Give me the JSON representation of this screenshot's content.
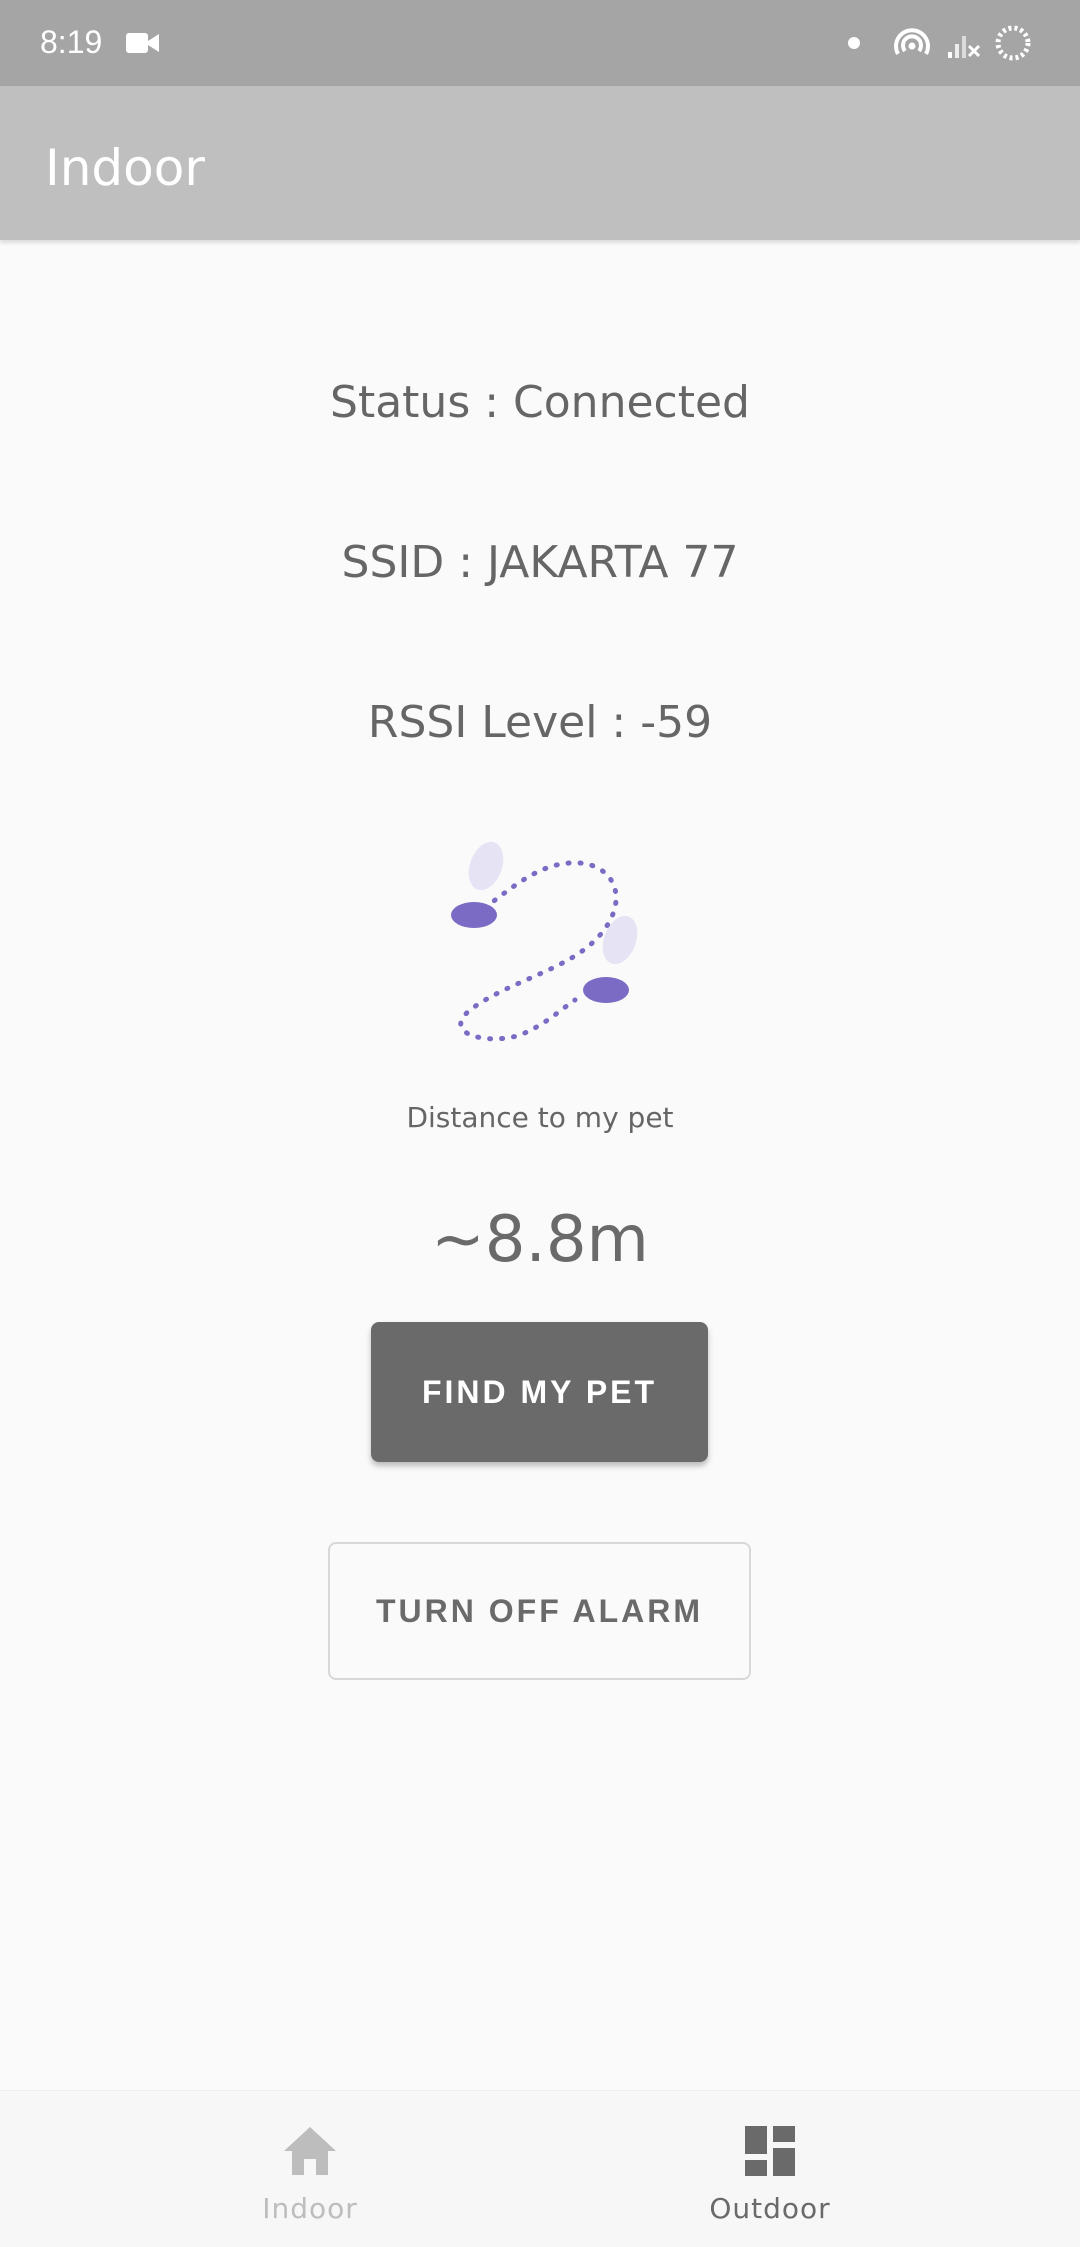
{
  "status_bar": {
    "time": "8:19",
    "icons": [
      "video-camera-icon",
      "dot-icon",
      "hotspot-icon",
      "signal-no-service-icon",
      "loading-circle-icon"
    ]
  },
  "app_bar": {
    "title": "Indoor"
  },
  "main": {
    "status_text": "Status : Connected",
    "ssid_text": "SSID : JAKARTA 77",
    "rssi_text": "RSSI Level : -59",
    "illustration_icon": "pet-footsteps-path-icon",
    "distance_label": "Distance to my pet",
    "distance_value": "~8.8m",
    "find_button_label": "FIND MY PET",
    "alarm_button_label": "TURN OFF ALARM"
  },
  "bottom_nav": {
    "items": [
      {
        "label": "Indoor",
        "icon": "home-icon",
        "color": "#bdbdbd"
      },
      {
        "label": "Outdoor",
        "icon": "dashboard-icon",
        "color": "#6a6a6a"
      }
    ]
  },
  "colors": {
    "status_bar": "#a5a5a5",
    "app_bar": "#bfbfbf",
    "background": "#fafafa",
    "primary_button": "#6a6a6a",
    "illustration_accent": "#7b6bc4",
    "illustration_light": "#e6e3f5"
  }
}
